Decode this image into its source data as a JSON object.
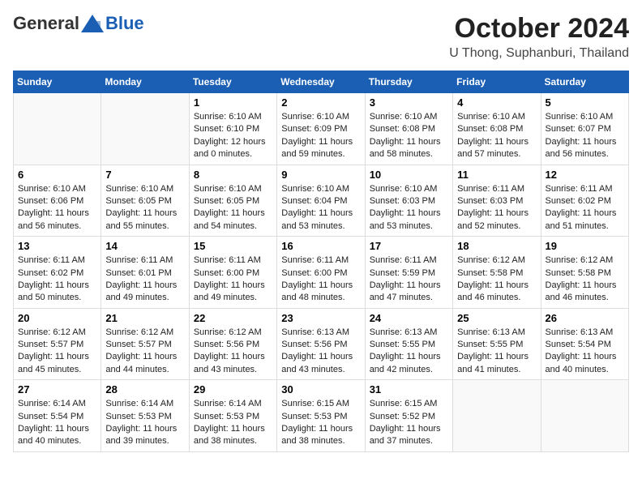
{
  "header": {
    "logo": {
      "general": "General",
      "blue": "Blue"
    },
    "title": "October 2024",
    "location": "U Thong, Suphanburi, Thailand"
  },
  "calendar": {
    "weekdays": [
      "Sunday",
      "Monday",
      "Tuesday",
      "Wednesday",
      "Thursday",
      "Friday",
      "Saturday"
    ],
    "weeks": [
      [
        {
          "day": "",
          "text": ""
        },
        {
          "day": "",
          "text": ""
        },
        {
          "day": "1",
          "text": "Sunrise: 6:10 AM\nSunset: 6:10 PM\nDaylight: 12 hours and 0 minutes."
        },
        {
          "day": "2",
          "text": "Sunrise: 6:10 AM\nSunset: 6:09 PM\nDaylight: 11 hours and 59 minutes."
        },
        {
          "day": "3",
          "text": "Sunrise: 6:10 AM\nSunset: 6:08 PM\nDaylight: 11 hours and 58 minutes."
        },
        {
          "day": "4",
          "text": "Sunrise: 6:10 AM\nSunset: 6:08 PM\nDaylight: 11 hours and 57 minutes."
        },
        {
          "day": "5",
          "text": "Sunrise: 6:10 AM\nSunset: 6:07 PM\nDaylight: 11 hours and 56 minutes."
        }
      ],
      [
        {
          "day": "6",
          "text": "Sunrise: 6:10 AM\nSunset: 6:06 PM\nDaylight: 11 hours and 56 minutes."
        },
        {
          "day": "7",
          "text": "Sunrise: 6:10 AM\nSunset: 6:05 PM\nDaylight: 11 hours and 55 minutes."
        },
        {
          "day": "8",
          "text": "Sunrise: 6:10 AM\nSunset: 6:05 PM\nDaylight: 11 hours and 54 minutes."
        },
        {
          "day": "9",
          "text": "Sunrise: 6:10 AM\nSunset: 6:04 PM\nDaylight: 11 hours and 53 minutes."
        },
        {
          "day": "10",
          "text": "Sunrise: 6:10 AM\nSunset: 6:03 PM\nDaylight: 11 hours and 53 minutes."
        },
        {
          "day": "11",
          "text": "Sunrise: 6:11 AM\nSunset: 6:03 PM\nDaylight: 11 hours and 52 minutes."
        },
        {
          "day": "12",
          "text": "Sunrise: 6:11 AM\nSunset: 6:02 PM\nDaylight: 11 hours and 51 minutes."
        }
      ],
      [
        {
          "day": "13",
          "text": "Sunrise: 6:11 AM\nSunset: 6:02 PM\nDaylight: 11 hours and 50 minutes."
        },
        {
          "day": "14",
          "text": "Sunrise: 6:11 AM\nSunset: 6:01 PM\nDaylight: 11 hours and 49 minutes."
        },
        {
          "day": "15",
          "text": "Sunrise: 6:11 AM\nSunset: 6:00 PM\nDaylight: 11 hours and 49 minutes."
        },
        {
          "day": "16",
          "text": "Sunrise: 6:11 AM\nSunset: 6:00 PM\nDaylight: 11 hours and 48 minutes."
        },
        {
          "day": "17",
          "text": "Sunrise: 6:11 AM\nSunset: 5:59 PM\nDaylight: 11 hours and 47 minutes."
        },
        {
          "day": "18",
          "text": "Sunrise: 6:12 AM\nSunset: 5:58 PM\nDaylight: 11 hours and 46 minutes."
        },
        {
          "day": "19",
          "text": "Sunrise: 6:12 AM\nSunset: 5:58 PM\nDaylight: 11 hours and 46 minutes."
        }
      ],
      [
        {
          "day": "20",
          "text": "Sunrise: 6:12 AM\nSunset: 5:57 PM\nDaylight: 11 hours and 45 minutes."
        },
        {
          "day": "21",
          "text": "Sunrise: 6:12 AM\nSunset: 5:57 PM\nDaylight: 11 hours and 44 minutes."
        },
        {
          "day": "22",
          "text": "Sunrise: 6:12 AM\nSunset: 5:56 PM\nDaylight: 11 hours and 43 minutes."
        },
        {
          "day": "23",
          "text": "Sunrise: 6:13 AM\nSunset: 5:56 PM\nDaylight: 11 hours and 43 minutes."
        },
        {
          "day": "24",
          "text": "Sunrise: 6:13 AM\nSunset: 5:55 PM\nDaylight: 11 hours and 42 minutes."
        },
        {
          "day": "25",
          "text": "Sunrise: 6:13 AM\nSunset: 5:55 PM\nDaylight: 11 hours and 41 minutes."
        },
        {
          "day": "26",
          "text": "Sunrise: 6:13 AM\nSunset: 5:54 PM\nDaylight: 11 hours and 40 minutes."
        }
      ],
      [
        {
          "day": "27",
          "text": "Sunrise: 6:14 AM\nSunset: 5:54 PM\nDaylight: 11 hours and 40 minutes."
        },
        {
          "day": "28",
          "text": "Sunrise: 6:14 AM\nSunset: 5:53 PM\nDaylight: 11 hours and 39 minutes."
        },
        {
          "day": "29",
          "text": "Sunrise: 6:14 AM\nSunset: 5:53 PM\nDaylight: 11 hours and 38 minutes."
        },
        {
          "day": "30",
          "text": "Sunrise: 6:15 AM\nSunset: 5:53 PM\nDaylight: 11 hours and 38 minutes."
        },
        {
          "day": "31",
          "text": "Sunrise: 6:15 AM\nSunset: 5:52 PM\nDaylight: 11 hours and 37 minutes."
        },
        {
          "day": "",
          "text": ""
        },
        {
          "day": "",
          "text": ""
        }
      ]
    ]
  }
}
